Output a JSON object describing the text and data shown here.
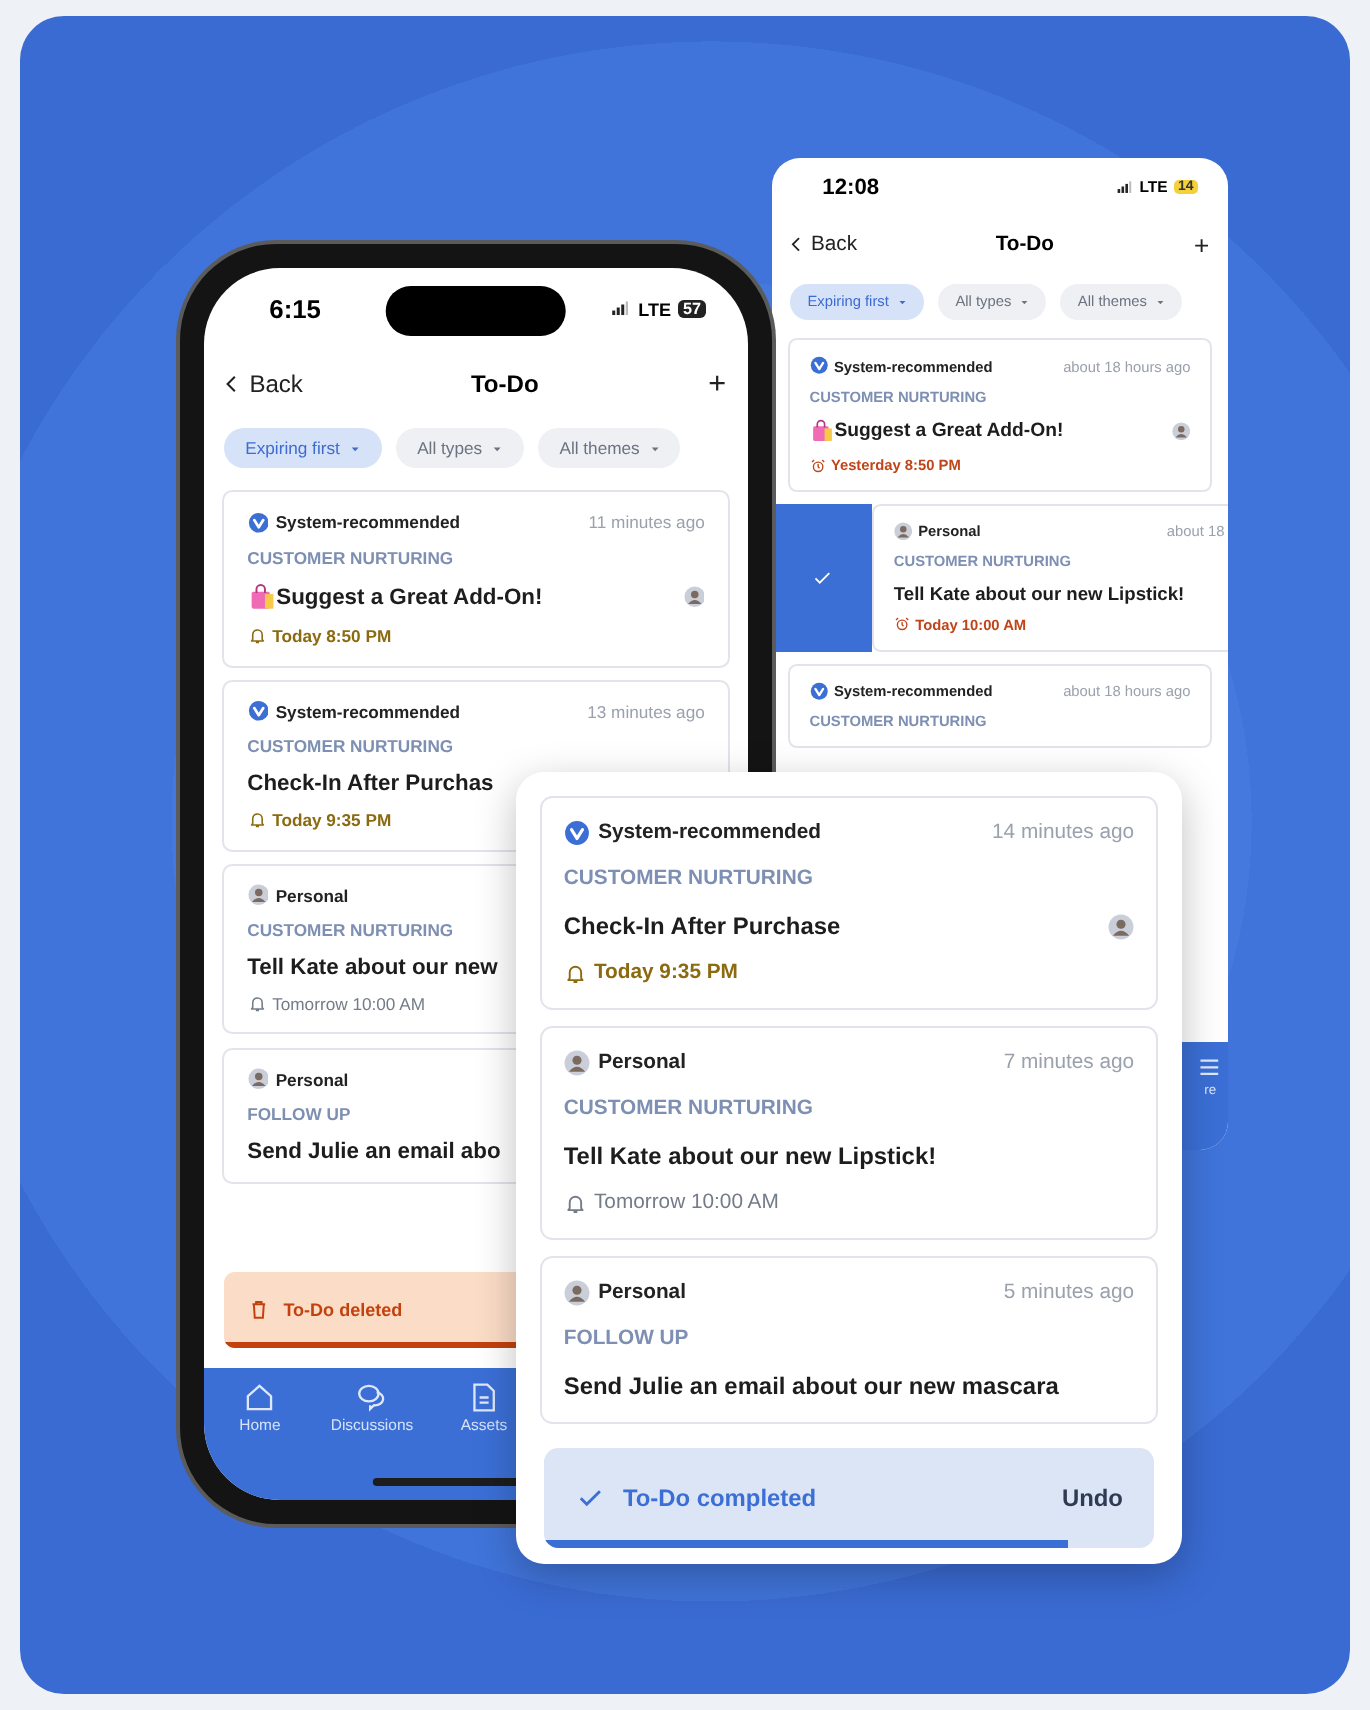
{
  "phone_main": {
    "status": {
      "time": "6:15",
      "network": "LTE",
      "battery": "57",
      "battery_low": false
    },
    "header": {
      "back": "Back",
      "title": "To-Do"
    },
    "filters": [
      {
        "label": "Expiring first",
        "selected": true
      },
      {
        "label": "All types",
        "selected": false
      },
      {
        "label": "All themes",
        "selected": false
      }
    ],
    "cards": [
      {
        "kind": "system",
        "source": "System-recommended",
        "time": "11 minutes ago",
        "category": "CUSTOMER NURTURING",
        "bag_icon": true,
        "title": "Suggest a Great Add-On!",
        "avatar": true,
        "reminder": {
          "kind": "today",
          "text": "Today 8:50 PM"
        },
        "swiped": false
      },
      {
        "kind": "system",
        "source": "System-recommended",
        "time": "13 minutes ago",
        "category": "CUSTOMER NURTURING",
        "bag_icon": false,
        "title": "Check-In After Purchas",
        "avatar": false,
        "reminder": {
          "kind": "today",
          "text": "Today 9:35 PM"
        },
        "swiped": false
      },
      {
        "kind": "personal",
        "source": "Personal",
        "category": "CUSTOMER NURTURING",
        "bag_icon": false,
        "title": "Tell Kate about our new",
        "avatar": false,
        "reminder": {
          "kind": "upcoming",
          "text": "Tomorrow 10:00 AM"
        },
        "swiped": false
      },
      {
        "kind": "personal",
        "source": "Personal",
        "category": "FOLLOW UP",
        "bag_icon": false,
        "title": "Send Julie an email abo",
        "avatar": false,
        "swiped": false
      }
    ],
    "toast": {
      "kind": "deleted",
      "text": "To-Do deleted",
      "level": 0.58
    },
    "nav": [
      {
        "label": "Home"
      },
      {
        "label": "Discussions"
      },
      {
        "label": "Assets"
      }
    ]
  },
  "phone_back": {
    "status": {
      "time": "12:08",
      "network": "LTE",
      "battery": "14",
      "battery_low": true
    },
    "header": {
      "back": "Back",
      "title": "To-Do"
    },
    "filters": [
      {
        "label": "Expiring first",
        "selected": true
      },
      {
        "label": "All types",
        "selected": false
      },
      {
        "label": "All themes",
        "selected": false
      }
    ],
    "cards": [
      {
        "kind": "system",
        "source": "System-recommended",
        "time": "about 18 hours ago",
        "category": "CUSTOMER NURTURING",
        "bag_icon": true,
        "title": "Suggest a Great Add-On!",
        "avatar": true,
        "reminder": {
          "kind": "overdue",
          "text": "Yesterday 8:50 PM"
        },
        "swiped": false
      },
      {
        "kind": "personal",
        "source": "Personal",
        "time": "about 18",
        "category": "CUSTOMER NURTURING",
        "bag_icon": false,
        "title": "Tell Kate about our new Lipstick!",
        "avatar": false,
        "reminder": {
          "kind": "overdue",
          "text": "Today 10:00 AM"
        },
        "swiped": true
      },
      {
        "kind": "system",
        "source": "System-recommended",
        "time": "about 18 hours ago",
        "category": "CUSTOMER NURTURING",
        "avatar": false,
        "swiped": false
      }
    ],
    "nav": [
      {
        "label": "re"
      }
    ]
  },
  "popup": {
    "cards": [
      {
        "kind": "system",
        "source": "System-recommended",
        "time": "14 minutes ago",
        "category": "CUSTOMER NURTURING",
        "bag_icon": false,
        "title": "Check-In After Purchase",
        "avatar": true,
        "reminder": {
          "kind": "today",
          "text": "Today 9:35 PM"
        },
        "swiped": false
      },
      {
        "kind": "personal",
        "source": "Personal",
        "time": "7 minutes ago",
        "category": "CUSTOMER NURTURING",
        "bag_icon": false,
        "title": "Tell Kate about our new Lipstick!",
        "avatar": false,
        "reminder": {
          "kind": "upcoming",
          "text": "Tomorrow 10:00 AM"
        },
        "swiped": false
      },
      {
        "kind": "personal",
        "source": "Personal",
        "time": "5 minutes ago",
        "category": "FOLLOW UP",
        "bag_icon": false,
        "title": "Send Julie an email about our new mascara",
        "avatar": false,
        "swiped": false
      }
    ],
    "toast": {
      "kind": "completed",
      "text": "To-Do completed",
      "action": "Undo",
      "level": 0.86
    }
  }
}
